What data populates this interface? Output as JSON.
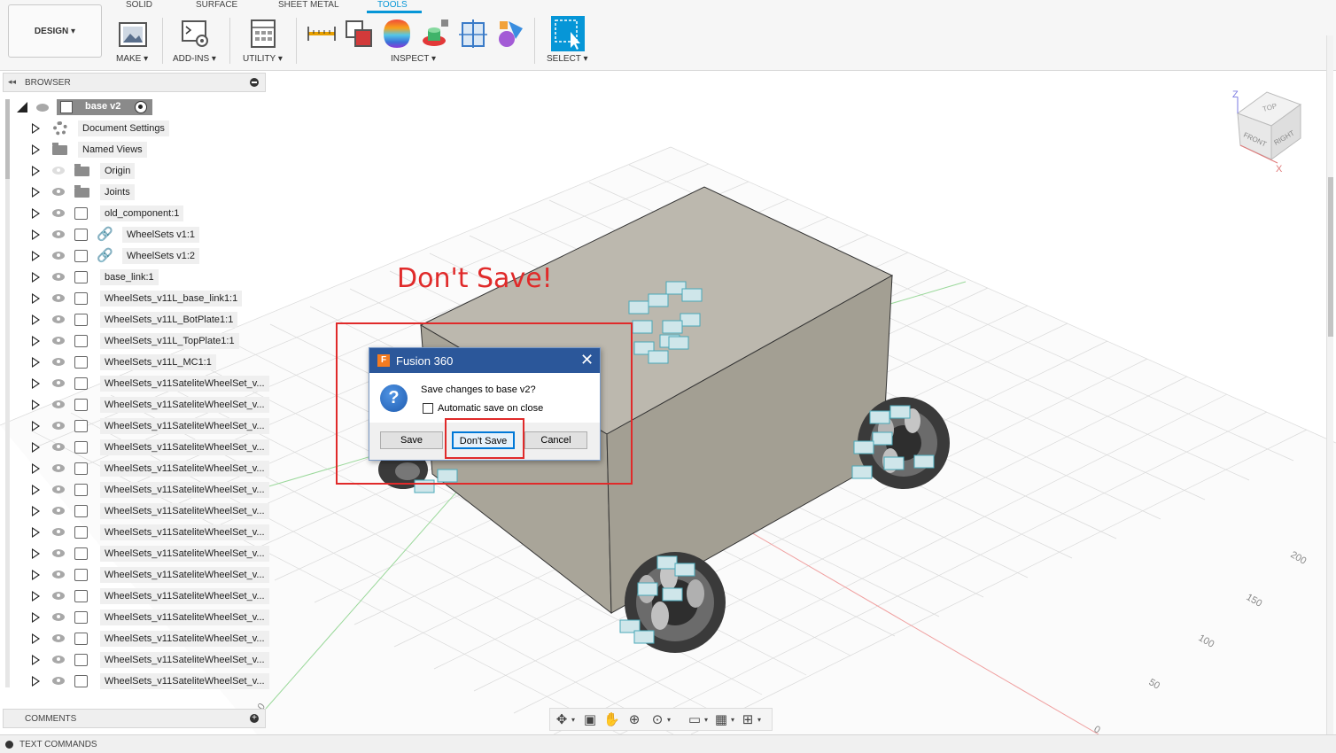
{
  "workspace_button": "DESIGN ▾",
  "tabs": [
    "SOLID",
    "SURFACE",
    "SHEET METAL",
    "TOOLS"
  ],
  "active_tab": "TOOLS",
  "groups": {
    "make": "MAKE ▾",
    "addins": "ADD-INS ▾",
    "utility": "UTILITY ▾",
    "inspect": "INSPECT ▾",
    "select": "SELECT ▾"
  },
  "browser": {
    "title": "BROWSER",
    "root": "base v2",
    "items": [
      "Document Settings",
      "Named Views",
      "Origin",
      "Joints",
      "old_component:1",
      "WheelSets v1:1",
      "WheelSets v1:2",
      "base_link:1",
      "WheelSets_v11L_base_link1:1",
      "WheelSets_v11L_BotPlate1:1",
      "WheelSets_v11L_TopPlate1:1",
      "WheelSets_v11L_MC1:1",
      "WheelSets_v11SateliteWheelSet_v...",
      "WheelSets_v11SateliteWheelSet_v...",
      "WheelSets_v11SateliteWheelSet_v...",
      "WheelSets_v11SateliteWheelSet_v...",
      "WheelSets_v11SateliteWheelSet_v...",
      "WheelSets_v11SateliteWheelSet_v...",
      "WheelSets_v11SateliteWheelSet_v...",
      "WheelSets_v11SateliteWheelSet_v...",
      "WheelSets_v11SateliteWheelSet_v...",
      "WheelSets_v11SateliteWheelSet_v...",
      "WheelSets_v11SateliteWheelSet_v...",
      "WheelSets_v11SateliteWheelSet_v...",
      "WheelSets_v11SateliteWheelSet_v...",
      "WheelSets_v11SateliteWheelSet_v...",
      "WheelSets_v11SateliteWheelSet_v..."
    ]
  },
  "comments_label": "COMMENTS",
  "text_commands_label": "TEXT COMMANDS",
  "annotation": "Don't Save!",
  "dialog": {
    "title": "Fusion 360",
    "app_icon": "F",
    "message": "Save changes to base v2?",
    "checkbox_label": "Automatic save on close",
    "save": "Save",
    "dont_save": "Don't Save",
    "cancel": "Cancel"
  },
  "viewcube": {
    "top": "TOP",
    "front": "FRONT",
    "right": "RIGHT",
    "axis_z": "Z",
    "axis_x": "X"
  },
  "grid_labels": [
    "200",
    "150",
    "100",
    "50",
    "0",
    "0"
  ],
  "colors": {
    "accent": "#0696d7",
    "dialog_title": "#2b579a",
    "annotation": "#e02a2a",
    "box_face_top": "#bcb8ae",
    "box_face_front": "#a9a599",
    "box_face_right": "#a39f93"
  }
}
